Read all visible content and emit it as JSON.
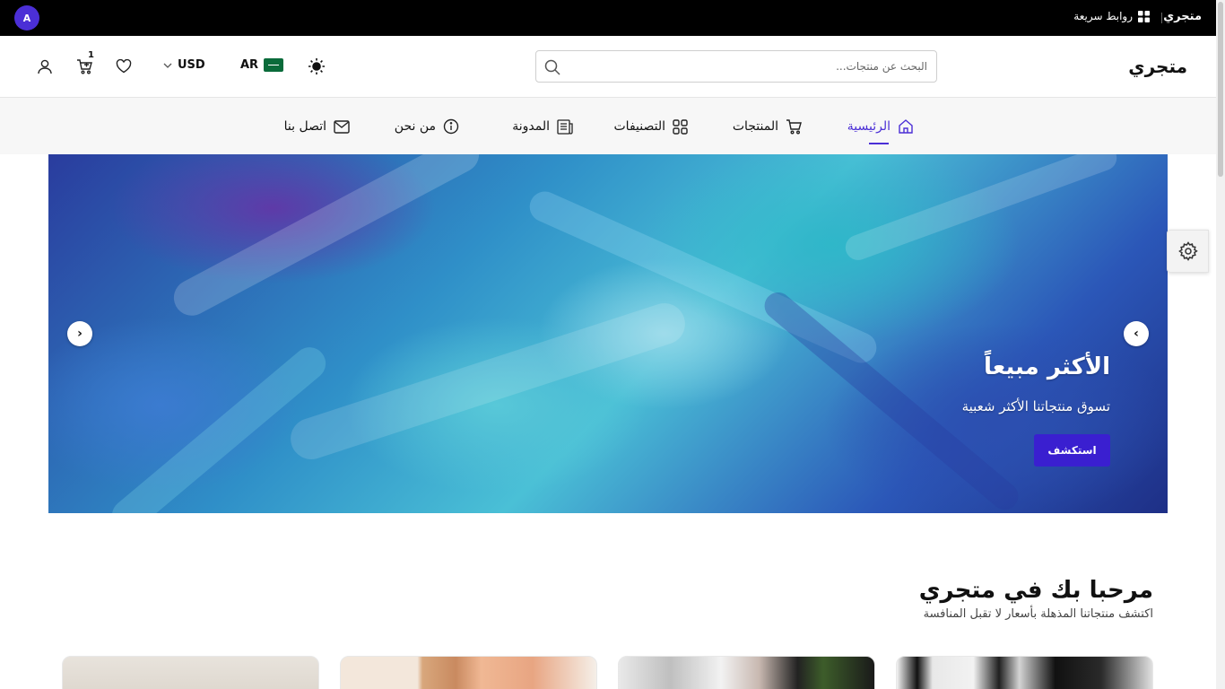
{
  "topbar": {
    "brand": "متجري",
    "quick_links": "روابط سريعة",
    "avatar_letter": "A"
  },
  "header": {
    "logo": "متجري",
    "search_placeholder": "البحث عن منتجات...",
    "language": "AR",
    "currency": "USD",
    "cart_count": "1"
  },
  "nav": {
    "items": [
      {
        "label": "الرئيسية",
        "icon": "home-icon",
        "active": true
      },
      {
        "label": "المنتجات",
        "icon": "cart-icon"
      },
      {
        "label": "التصنيفات",
        "icon": "grid-icon"
      },
      {
        "label": "المدونة",
        "icon": "newspaper-icon"
      },
      {
        "label": "من نحن",
        "icon": "info-icon"
      },
      {
        "label": "اتصل بنا",
        "icon": "mail-icon"
      }
    ]
  },
  "hero": {
    "title": "الأكثر مبيعاً",
    "subtitle": "تسوق منتجاتنا الأكثر شعبية",
    "button": "استكشف",
    "prev": "‹",
    "next": "›"
  },
  "welcome": {
    "title": "مرحبا بك في متجري",
    "subtitle": "اكتشف منتجاتنا المذهلة بأسعار لا تقبل المنافسة"
  },
  "colors": {
    "accent": "#4b2fd6",
    "topbar": "#000000"
  }
}
